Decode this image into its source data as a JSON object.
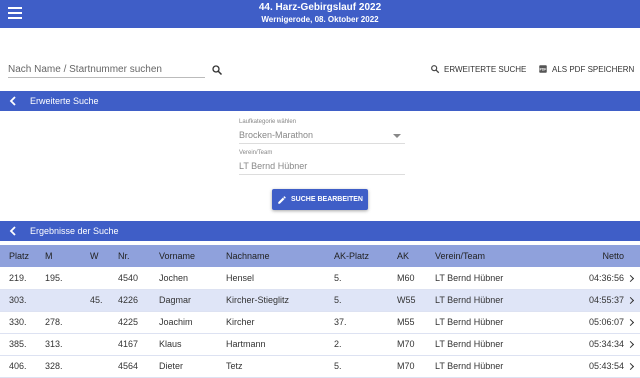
{
  "header": {
    "title": "44. Harz-Gebirgslauf 2022",
    "subtitle": "Wernigerode, 08. Oktober 2022"
  },
  "search": {
    "placeholder": "Nach Name / Startnummer suchen"
  },
  "actions": {
    "advanced_search": "ERWEITERTE SUCHE",
    "save_pdf": "ALS PDF SPEICHERN"
  },
  "advanced": {
    "section_title": "Erweiterte Suche",
    "category_label": "Laufkategorie wählen",
    "category_value": "Brocken-Marathon",
    "team_label": "Verein/Team",
    "team_value": "LT Bernd Hübner",
    "edit_button": "SUCHE BEARBEITEN"
  },
  "results": {
    "section_title": "Ergebnisse der Suche",
    "columns": [
      "Platz",
      "M",
      "W",
      "Nr.",
      "Vorname",
      "Nachname",
      "AK-Platz",
      "AK",
      "Verein/Team",
      "Netto"
    ],
    "rows": [
      {
        "platz": "219.",
        "m": "195.",
        "w": "",
        "nr": "4540",
        "vorname": "Jochen",
        "nachname": "Hensel",
        "ak_platz": "5.",
        "ak": "M60",
        "team": "LT Bernd Hübner",
        "netto": "04:36:56"
      },
      {
        "platz": "303.",
        "m": "",
        "w": "45.",
        "nr": "4226",
        "vorname": "Dagmar",
        "nachname": "Kircher-Stieglitz",
        "ak_platz": "5.",
        "ak": "W55",
        "team": "LT Bernd Hübner",
        "netto": "04:55:37"
      },
      {
        "platz": "330.",
        "m": "278.",
        "w": "",
        "nr": "4225",
        "vorname": "Joachim",
        "nachname": "Kircher",
        "ak_platz": "37.",
        "ak": "M55",
        "team": "LT Bernd Hübner",
        "netto": "05:06:07"
      },
      {
        "platz": "385.",
        "m": "313.",
        "w": "",
        "nr": "4167",
        "vorname": "Klaus",
        "nachname": "Hartmann",
        "ak_platz": "2.",
        "ak": "M70",
        "team": "LT Bernd Hübner",
        "netto": "05:34:34"
      },
      {
        "platz": "406.",
        "m": "328.",
        "w": "",
        "nr": "4564",
        "vorname": "Dieter",
        "nachname": "Tetz",
        "ak_platz": "5.",
        "ak": "M70",
        "team": "LT Bernd Hübner",
        "netto": "05:43:54"
      }
    ]
  }
}
